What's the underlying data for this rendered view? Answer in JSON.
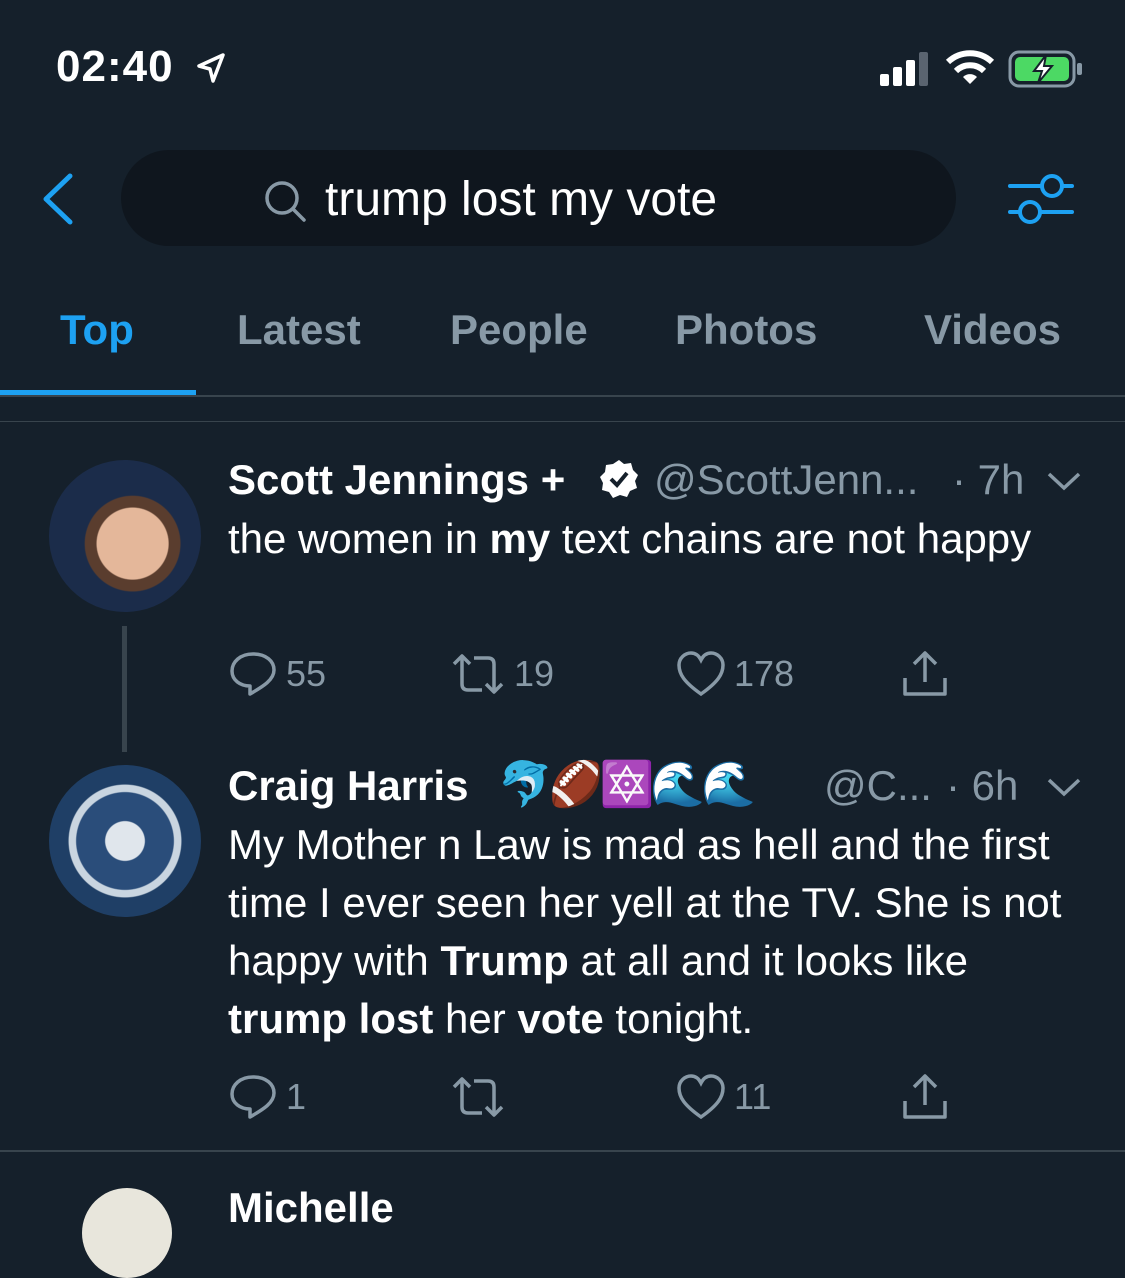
{
  "status_bar": {
    "time": "02:40",
    "icons": [
      "location-arrow-icon",
      "signal-icon",
      "wifi-icon",
      "battery-charging-icon"
    ]
  },
  "search": {
    "query": "trump lost my vote"
  },
  "tabs": [
    {
      "label": "Top",
      "active": true
    },
    {
      "label": "Latest"
    },
    {
      "label": "People"
    },
    {
      "label": "Photos"
    },
    {
      "label": "Videos"
    }
  ],
  "accent_color": "#1da1f2",
  "tweets": [
    {
      "name": "Scott Jennings +",
      "verified": true,
      "handle": "@ScottJenn...",
      "time": "· 7h",
      "body_parts": [
        "the women in ",
        "my",
        " text chains are not happy"
      ],
      "replies": "55",
      "retweets": "19",
      "likes": "178"
    },
    {
      "name": "Craig Harris",
      "emoji": "🐬🏈🔯🌊🌊",
      "handle": "@C...",
      "time": "· 6h",
      "body_parts": [
        "My Mother n Law is mad as hell and the first time I ever seen her yell at the TV. She is not happy with ",
        "Trump",
        " at all and it looks like ",
        "trump lost",
        " her ",
        "vote",
        " tonight."
      ],
      "replies": "1",
      "retweets": "",
      "likes": "11"
    },
    {
      "name": "Michelle"
    }
  ]
}
